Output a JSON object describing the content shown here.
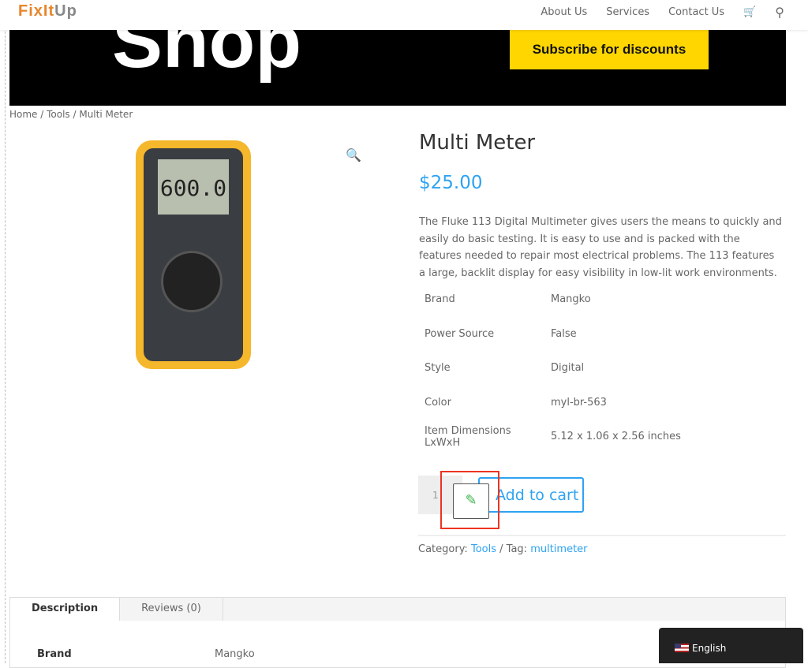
{
  "header": {
    "logo_a": "FixIt",
    "logo_b": "Up",
    "nav": [
      "About Us",
      "Services",
      "Contact Us"
    ],
    "cart_icon": "cart-icon",
    "search_icon": "search-icon"
  },
  "hero": {
    "title": "Shop",
    "subscribe": "Subscribe for discounts"
  },
  "breadcrumb": "Home / Tools / Multi Meter",
  "product": {
    "lcd": "600.0",
    "title": "Multi Meter",
    "price": "$25.00",
    "description": "The Fluke 113 Digital Multimeter gives users the means to quickly and easily do basic testing. It is easy to use and is packed with the features needed to repair most electrical problems. The 113 features a large, backlit display for easy visibility in low-lit work environments.",
    "attributes": [
      {
        "k": "Brand",
        "v": "Mangko"
      },
      {
        "k": "Power Source",
        "v": "False"
      },
      {
        "k": "Style",
        "v": "Digital"
      },
      {
        "k": "Color",
        "v": "myl-br-563"
      },
      {
        "k": "Item Dimensions LxWxH",
        "v": "5.12 x 1.06 x 2.56 inches"
      }
    ],
    "quantity": "1",
    "add_to_cart": "Add to cart",
    "category_label": "Category:",
    "category": "Tools",
    "tag_label": "/ Tag:",
    "tag": "multimeter"
  },
  "tabs": [
    {
      "label": "Description"
    },
    {
      "label": "Reviews (0)"
    }
  ],
  "tab_row": {
    "k": "Brand",
    "v": "Mangko"
  },
  "language": "English",
  "colors": {
    "accent": "#2ea3f2",
    "subscribe_bg": "#ffd600",
    "logo": "#e8852a"
  }
}
